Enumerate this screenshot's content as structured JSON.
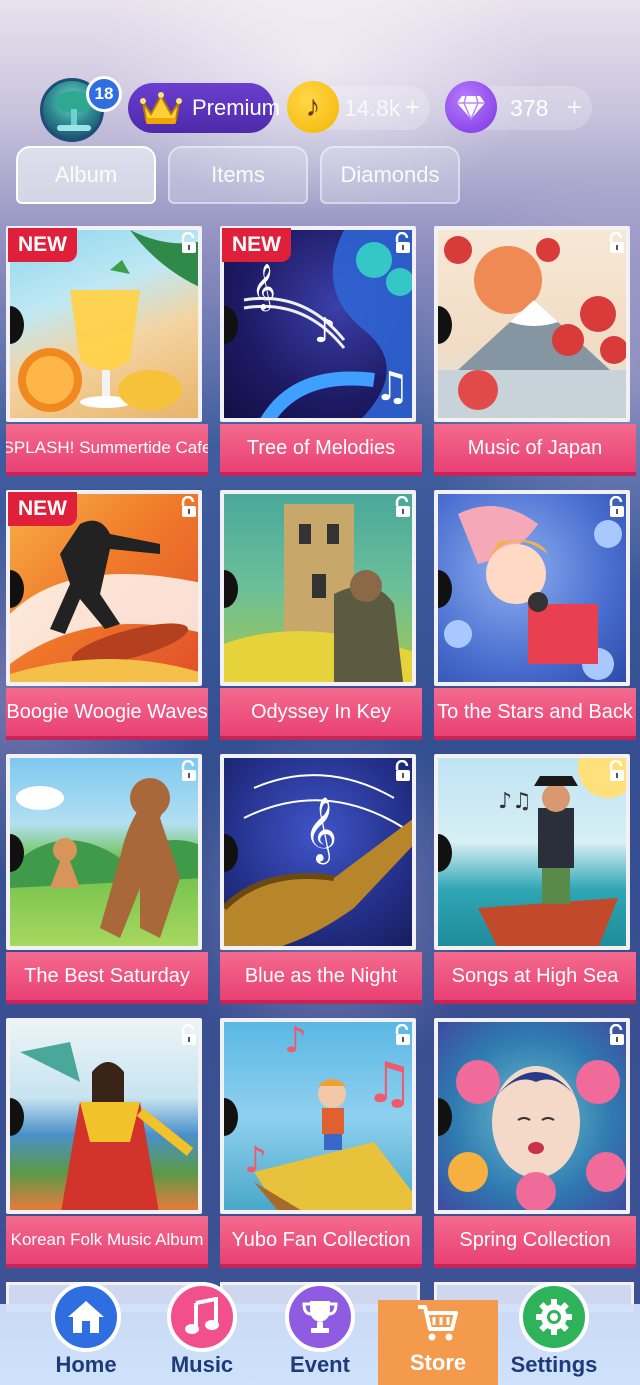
{
  "header": {
    "level": "18",
    "premium_label": "Premium",
    "coins_value": "14.8k",
    "coins_plus": "+",
    "diamonds_value": "378",
    "diamonds_plus": "+"
  },
  "tabs": [
    {
      "label": "Album",
      "active": true
    },
    {
      "label": "Items",
      "active": false
    },
    {
      "label": "Diamonds",
      "active": false
    }
  ],
  "new_badge": "NEW",
  "albums": [
    {
      "title": "SPLASH! Summertide Cafe",
      "new": true,
      "art": "summer-drink"
    },
    {
      "title": "Tree of Melodies",
      "new": true,
      "art": "music-tree"
    },
    {
      "title": "Music of Japan",
      "new": false,
      "art": "mount-fuji"
    },
    {
      "title": "Boogie Woogie Waves",
      "new": true,
      "art": "surfer"
    },
    {
      "title": "Odyssey In Key",
      "new": false,
      "art": "tower"
    },
    {
      "title": "To the Stars and Back",
      "new": false,
      "art": "sleeping-girl"
    },
    {
      "title": "The Best Saturday",
      "new": false,
      "art": "dogs"
    },
    {
      "title": "Blue as the Night",
      "new": false,
      "art": "saxophone"
    },
    {
      "title": "Songs at High Sea",
      "new": false,
      "art": "pirate"
    },
    {
      "title": "Korean Folk Music Album",
      "new": false,
      "art": "hanbok-dancer"
    },
    {
      "title": "Yubo Fan Collection",
      "new": false,
      "art": "boy-on-cliff"
    },
    {
      "title": "Spring Collection",
      "new": false,
      "art": "flower-woman"
    }
  ],
  "nav": [
    {
      "label": "Home",
      "icon": "home-icon",
      "color": "#2f6ee0"
    },
    {
      "label": "Music",
      "icon": "music-note-icon",
      "color": "#f2508c"
    },
    {
      "label": "Event",
      "icon": "trophy-icon",
      "color": "#8f5be0"
    },
    {
      "label": "Store",
      "icon": "cart-icon",
      "color": "#f39a4c"
    },
    {
      "label": "Settings",
      "icon": "gear-icon",
      "color": "#2fb35a"
    }
  ]
}
